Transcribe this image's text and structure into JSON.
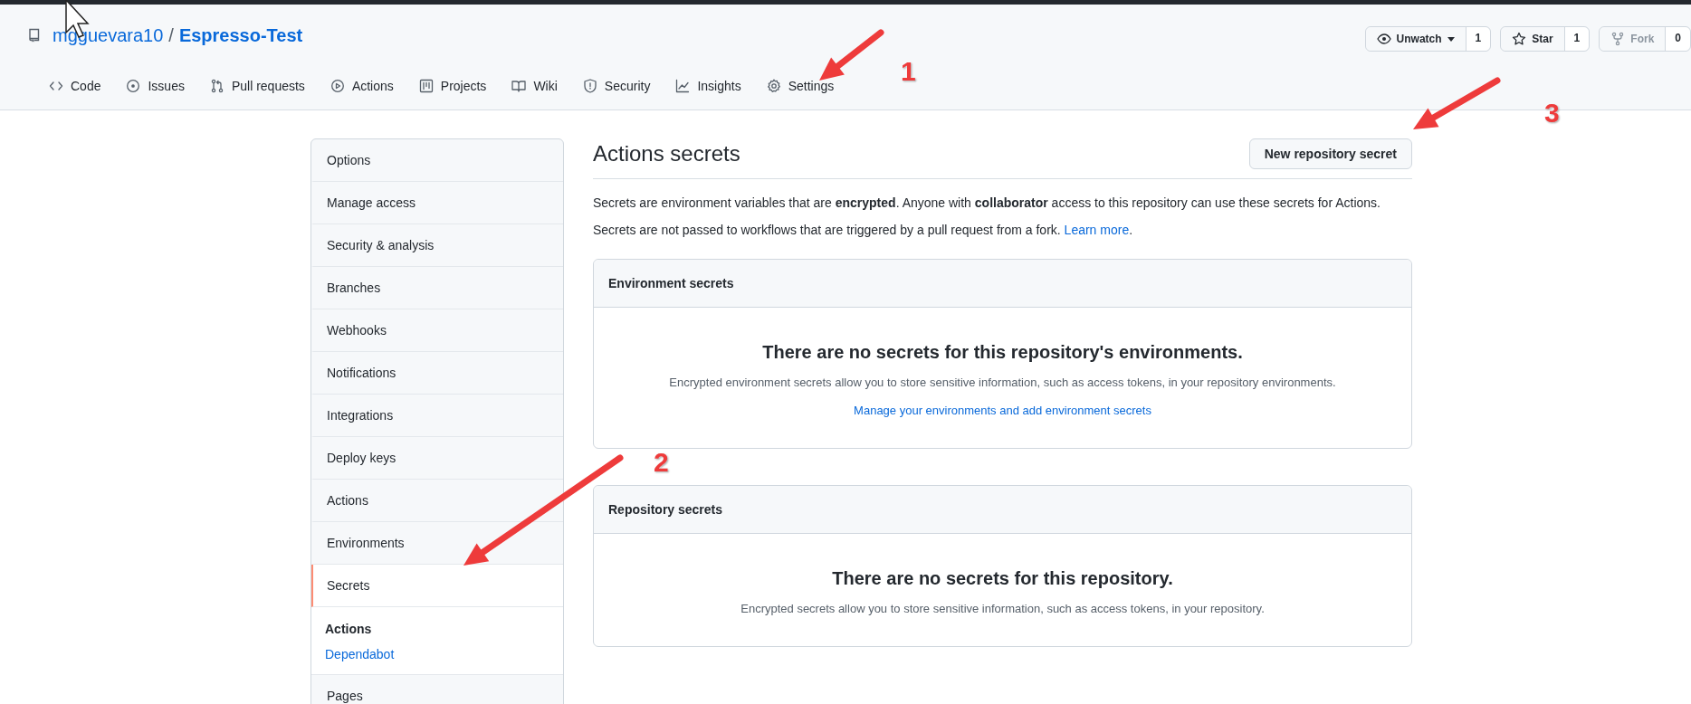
{
  "repo": {
    "owner": "mgguevara10",
    "separator": "/",
    "name": "Espresso-Test"
  },
  "repo_actions": [
    {
      "kind": "watch",
      "label": "Unwatch",
      "count": "1",
      "disabled": false
    },
    {
      "kind": "star",
      "label": "Star",
      "count": "1",
      "disabled": false
    },
    {
      "kind": "fork",
      "label": "Fork",
      "count": "0",
      "disabled": true
    }
  ],
  "tabs": [
    {
      "kind": "code",
      "label": "Code"
    },
    {
      "kind": "issues",
      "label": "Issues"
    },
    {
      "kind": "pulls",
      "label": "Pull requests"
    },
    {
      "kind": "actions",
      "label": "Actions"
    },
    {
      "kind": "projects",
      "label": "Projects"
    },
    {
      "kind": "wiki",
      "label": "Wiki"
    },
    {
      "kind": "security",
      "label": "Security"
    },
    {
      "kind": "insights",
      "label": "Insights"
    },
    {
      "kind": "settings",
      "label": "Settings"
    }
  ],
  "sidebar": {
    "sections": [
      {
        "kind": "items",
        "items": [
          {
            "label": "Options",
            "selected": false
          },
          {
            "label": "Manage access",
            "selected": false
          },
          {
            "label": "Security & analysis",
            "selected": false
          },
          {
            "label": "Branches",
            "selected": false
          },
          {
            "label": "Webhooks",
            "selected": false
          },
          {
            "label": "Notifications",
            "selected": false
          },
          {
            "label": "Integrations",
            "selected": false
          },
          {
            "label": "Deploy keys",
            "selected": false
          },
          {
            "label": "Actions",
            "selected": false
          },
          {
            "label": "Environments",
            "selected": false
          },
          {
            "label": "Secrets",
            "selected": true
          }
        ]
      },
      {
        "kind": "group",
        "heading": "Actions",
        "links": [
          "Dependabot"
        ]
      },
      {
        "kind": "items",
        "items": [
          {
            "label": "Pages",
            "selected": false
          }
        ]
      }
    ]
  },
  "main": {
    "title": "Actions secrets",
    "new_button": "New repository secret",
    "intro": "Secrets are environment variables that are **encrypted**. Anyone with **collaborator** access to this repository can use these secrets for Actions.",
    "note": {
      "text": "Secrets are not passed to workflows that are triggered by a pull request from a fork.",
      "link": "Learn more",
      "after": "."
    },
    "boxes": [
      {
        "header": "Environment secrets",
        "title": "There are no secrets for this repository's environments.",
        "description": "Encrypted environment secrets allow you to store sensitive information, such as access tokens, in your repository environments.",
        "link": "Manage your environments and add environment secrets"
      },
      {
        "header": "Repository secrets",
        "title": "There are no secrets for this repository.",
        "description": "Encrypted secrets allow you to store sensitive information, such as access tokens, in your repository."
      }
    ]
  },
  "annotations": [
    {
      "label": "1"
    },
    {
      "label": "2"
    },
    {
      "label": "3"
    }
  ]
}
